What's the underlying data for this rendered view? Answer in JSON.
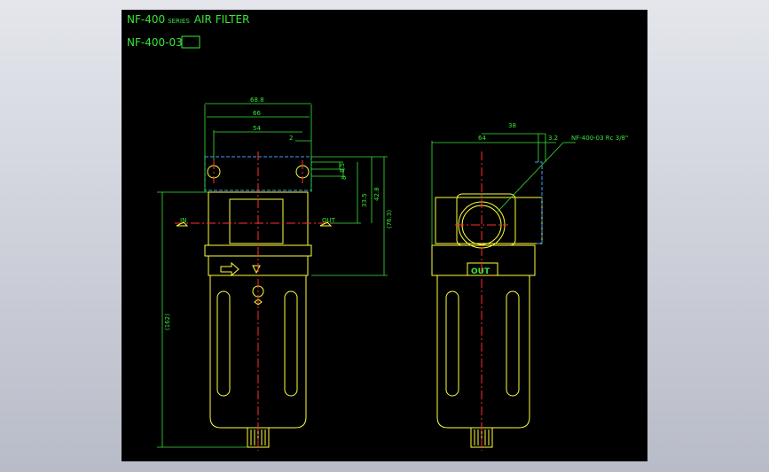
{
  "title": {
    "main": "NF-400",
    "series": "SERIES",
    "rest": "AIR FILTER",
    "model_prefix": "NF-400-",
    "model_boxed": "03"
  },
  "dimensions": {
    "width_overall": "68.8",
    "width_body": "66",
    "width_mount": "54",
    "small_gap": "2",
    "hole_a": "8.5",
    "hole_b": "8",
    "height_a": "33.5",
    "height_b": "42.8",
    "height_c": "(76.3)",
    "height_total": "(162)",
    "side_width": "64",
    "side_offset": "38",
    "side_small": "3.2"
  },
  "labels": {
    "port_callout": "NF-400-03 Rc 3/8\"",
    "out_label": "OUT",
    "in_label": "IN"
  },
  "colors": {
    "outline": "#ffff3a",
    "dimension": "#39e639",
    "centerline": "#ff3030",
    "hidden": "#3aa0ff",
    "background": "#000000"
  }
}
